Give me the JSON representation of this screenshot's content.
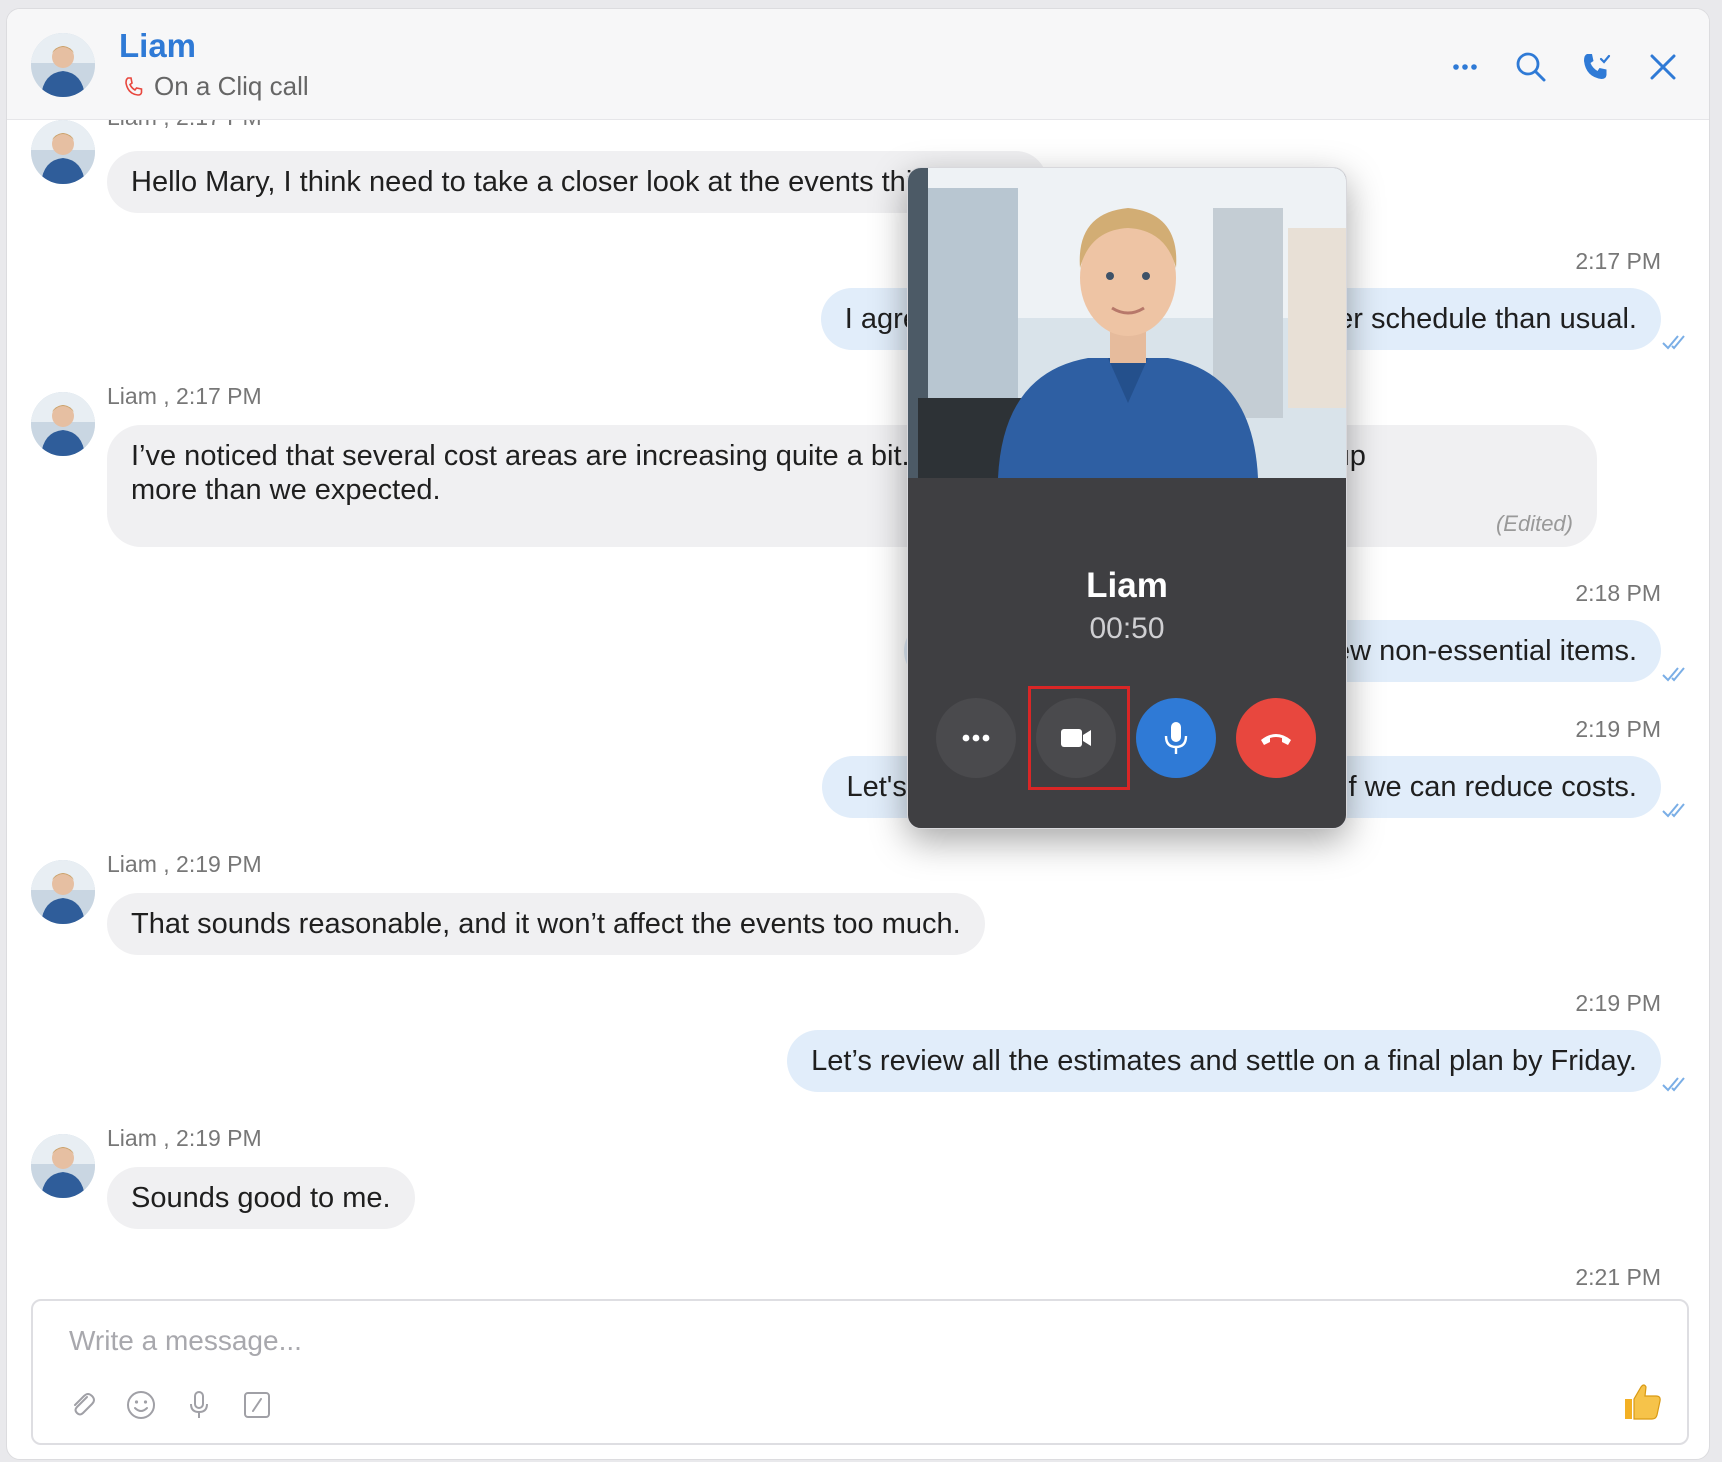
{
  "header": {
    "contact_name": "Liam",
    "status": "On a Cliq call",
    "icons": [
      "more-icon",
      "search-icon",
      "call-icon",
      "close-icon"
    ]
  },
  "messages": [
    {
      "sender": "Liam",
      "meta": "Liam , 2:17 PM",
      "text": "Hello Mary, I think need to take a closer look at the events this month.",
      "direction": "incoming"
    },
    {
      "time": "2:17 PM",
      "text": "I agree, it seems we've got a much fuller schedule than usual.",
      "direction": "outgoing"
    },
    {
      "sender": "Liam",
      "meta": "Liam , 2:17 PM",
      "text_line1": "I’ve noticed that several cost areas are increasing quite a bit. Vendors, in particular, are going up",
      "text_line2": "more than we expected.",
      "edited": "(Edited)",
      "direction": "incoming"
    },
    {
      "time": "2:18 PM",
      "text": "We may have to cut back on a few non-essential items.",
      "direction": "outgoing"
    },
    {
      "time": "2:19 PM",
      "text": "Let's review all of the line items to see if we can reduce costs.",
      "direction": "outgoing"
    },
    {
      "sender": "Liam",
      "meta": "Liam , 2:19 PM",
      "text": "That sounds reasonable, and it won’t affect the events too much.",
      "direction": "incoming"
    },
    {
      "time": "2:19 PM",
      "text": "Let’s review all the estimates and settle on a final plan by Friday.",
      "direction": "outgoing"
    },
    {
      "sender": "Liam",
      "meta": "Liam , 2:19 PM",
      "text": "Sounds good to me.",
      "direction": "incoming"
    },
    {
      "time": "2:21 PM"
    }
  ],
  "composer": {
    "placeholder": "Write a message...",
    "tools": [
      "attach-icon",
      "emoji-icon",
      "voice-icon",
      "format-icon"
    ],
    "send_icon": "thumbs-up-icon"
  },
  "call": {
    "name": "Liam",
    "duration": "00:50",
    "buttons": [
      "more-options",
      "video",
      "microphone",
      "end-call"
    ],
    "highlighted_button": "video"
  },
  "colors": {
    "accent": "#2f7ad6",
    "end_call": "#e8473e",
    "outgoing_bubble": "#e1edfa",
    "incoming_bubble": "#f0f0f2"
  }
}
